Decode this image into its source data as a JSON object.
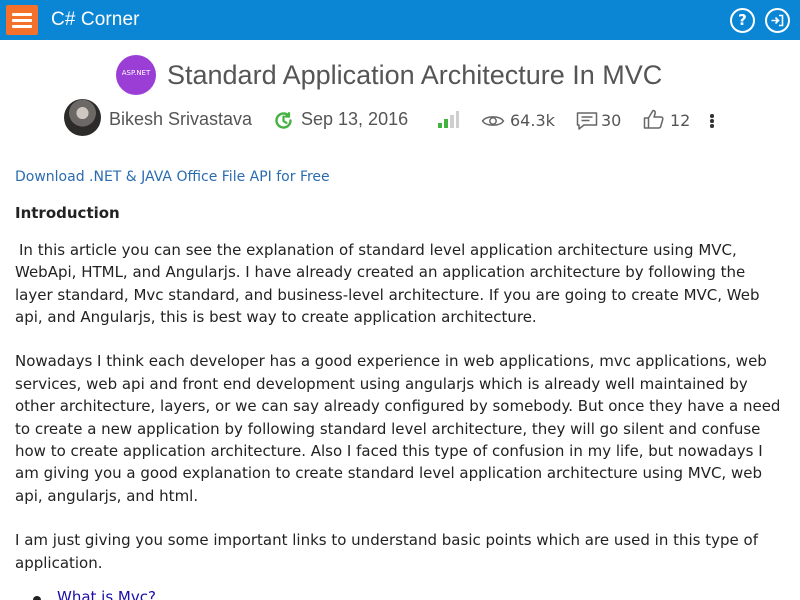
{
  "header": {
    "brand": "C# Corner",
    "help_glyph": "?",
    "login_label": "login"
  },
  "article": {
    "logo_text": "ASP.NET",
    "title": "Standard Application Architecture In MVC",
    "author": "Bikesh Srivastava",
    "date": "Sep 13, 2016",
    "views": "64.3k",
    "comments": "30",
    "likes": "12"
  },
  "body": {
    "download_link": "Download .NET & JAVA Office File API for Free",
    "heading": "Introduction",
    "para1": "In this article you can see the explanation of standard level application architecture using MVC, WebApi, HTML, and Angularjs. I have already created an application architecture by  following the layer standard, Mvc standard, and business-level architecture. If you are going to create MVC, Web api, and Angularjs, this is best way to create application architecture.",
    "para2": "Nowadays I think each developer has a good experience in web applications, mvc applications, web services, web api and front end development using angularjs which is already well maintained by other architecture, layers, or we can say already configured by somebody. But once they have a need  to create a new application by following standard level architecture, they will go silent and confuse how to create application architecture. Also I  faced this type of confusion in my life, but nowadays I am giving you a good explanation to create standard level application architecture using MVC, web api, angularjs, and html.",
    "para3": "I am just giving you some important links to understand basic points which are used in this type of application.",
    "list": [
      "What is Mvc?"
    ]
  },
  "colors": {
    "header_bg": "#0b86d4",
    "menu_button": "#f3712b",
    "logo_bg": "#9a3ed6",
    "link": "#2b6cb0",
    "accent_green": "#44b241"
  },
  "icons": [
    "menu-icon",
    "help-icon",
    "login-icon",
    "clock-refresh-icon",
    "signal-bars-icon",
    "eye-icon",
    "comment-icon",
    "thumbs-up-icon",
    "more-vertical-icon"
  ]
}
